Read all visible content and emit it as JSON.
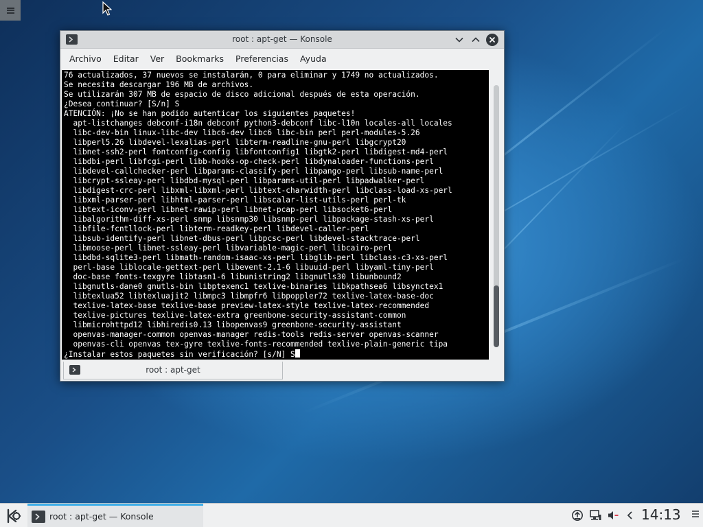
{
  "colors": {
    "accent": "#3daee9",
    "terminal_bg": "#000000",
    "terminal_fg": "#ffffff"
  },
  "window": {
    "title": "root : apt-get — Konsole",
    "icon": "terminal-icon",
    "menu": [
      "Archivo",
      "Editar",
      "Ver",
      "Bookmarks",
      "Preferencias",
      "Ayuda"
    ],
    "terminal_lines": [
      "76 actualizados, 37 nuevos se instalarán, 0 para eliminar y 1749 no actualizados.",
      "Se necesita descargar 196 MB de archivos.",
      "Se utilizarán 307 MB de espacio de disco adicional después de esta operación.",
      "¿Desea continuar? [S/n] S",
      "ATENCIÓN: ¡No se han podido autenticar los siguientes paquetes!",
      "  apt-listchanges debconf-i18n debconf python3-debconf libc-l10n locales-all locales",
      "  libc-dev-bin linux-libc-dev libc6-dev libc6 libc-bin perl perl-modules-5.26",
      "  libperl5.26 libdevel-lexalias-perl libterm-readline-gnu-perl libgcrypt20",
      "  libnet-ssh2-perl fontconfig-config libfontconfig1 libgtk2-perl libdigest-md4-perl",
      "  libdbi-perl libfcgi-perl libb-hooks-op-check-perl libdynaloader-functions-perl",
      "  libdevel-callchecker-perl libparams-classify-perl libpango-perl libsub-name-perl",
      "  libcrypt-ssleay-perl libdbd-mysql-perl libparams-util-perl libpadwalker-perl",
      "  libdigest-crc-perl libxml-libxml-perl libtext-charwidth-perl libclass-load-xs-perl",
      "  libxml-parser-perl libhtml-parser-perl libscalar-list-utils-perl perl-tk",
      "  libtext-iconv-perl libnet-rawip-perl libnet-pcap-perl libsocket6-perl",
      "  libalgorithm-diff-xs-perl snmp libsnmp30 libsnmp-perl libpackage-stash-xs-perl",
      "  libfile-fcntllock-perl libterm-readkey-perl libdevel-caller-perl",
      "  libsub-identify-perl libnet-dbus-perl libpcsc-perl libdevel-stacktrace-perl",
      "  libmoose-perl libnet-ssleay-perl libvariable-magic-perl libcairo-perl",
      "  libdbd-sqlite3-perl libmath-random-isaac-xs-perl libglib-perl libclass-c3-xs-perl",
      "  perl-base liblocale-gettext-perl libevent-2.1-6 libuuid-perl libyaml-tiny-perl",
      "  doc-base fonts-texgyre libtasn1-6 libunistring2 libgnutls30 libunbound2",
      "  libgnutls-dane0 gnutls-bin libptexenc1 texlive-binaries libkpathsea6 libsynctex1",
      "  libtexlua52 libtexluajit2 libmpc3 libmpfr6 libpoppler72 texlive-latex-base-doc",
      "  texlive-latex-base texlive-base preview-latex-style texlive-latex-recommended",
      "  texlive-pictures texlive-latex-extra greenbone-security-assistant-common",
      "  libmicrohttpd12 libhiredis0.13 libopenvas9 greenbone-security-assistant",
      "  openvas-manager-common openvas-manager redis-tools redis-server openvas-scanner",
      "  openvas-cli openvas tex-gyre texlive-fonts-recommended texlive-plain-generic tipa",
      "¿Instalar estos paquetes sin verificación? [s/N] S"
    ],
    "tab_label": "root : apt-get"
  },
  "taskbar": {
    "task_label": "root : apt-get — Konsole",
    "clock": "14:13",
    "tray_icons": [
      "updates-icon",
      "network-icon",
      "volume-muted-icon",
      "expand-tray-icon"
    ]
  }
}
